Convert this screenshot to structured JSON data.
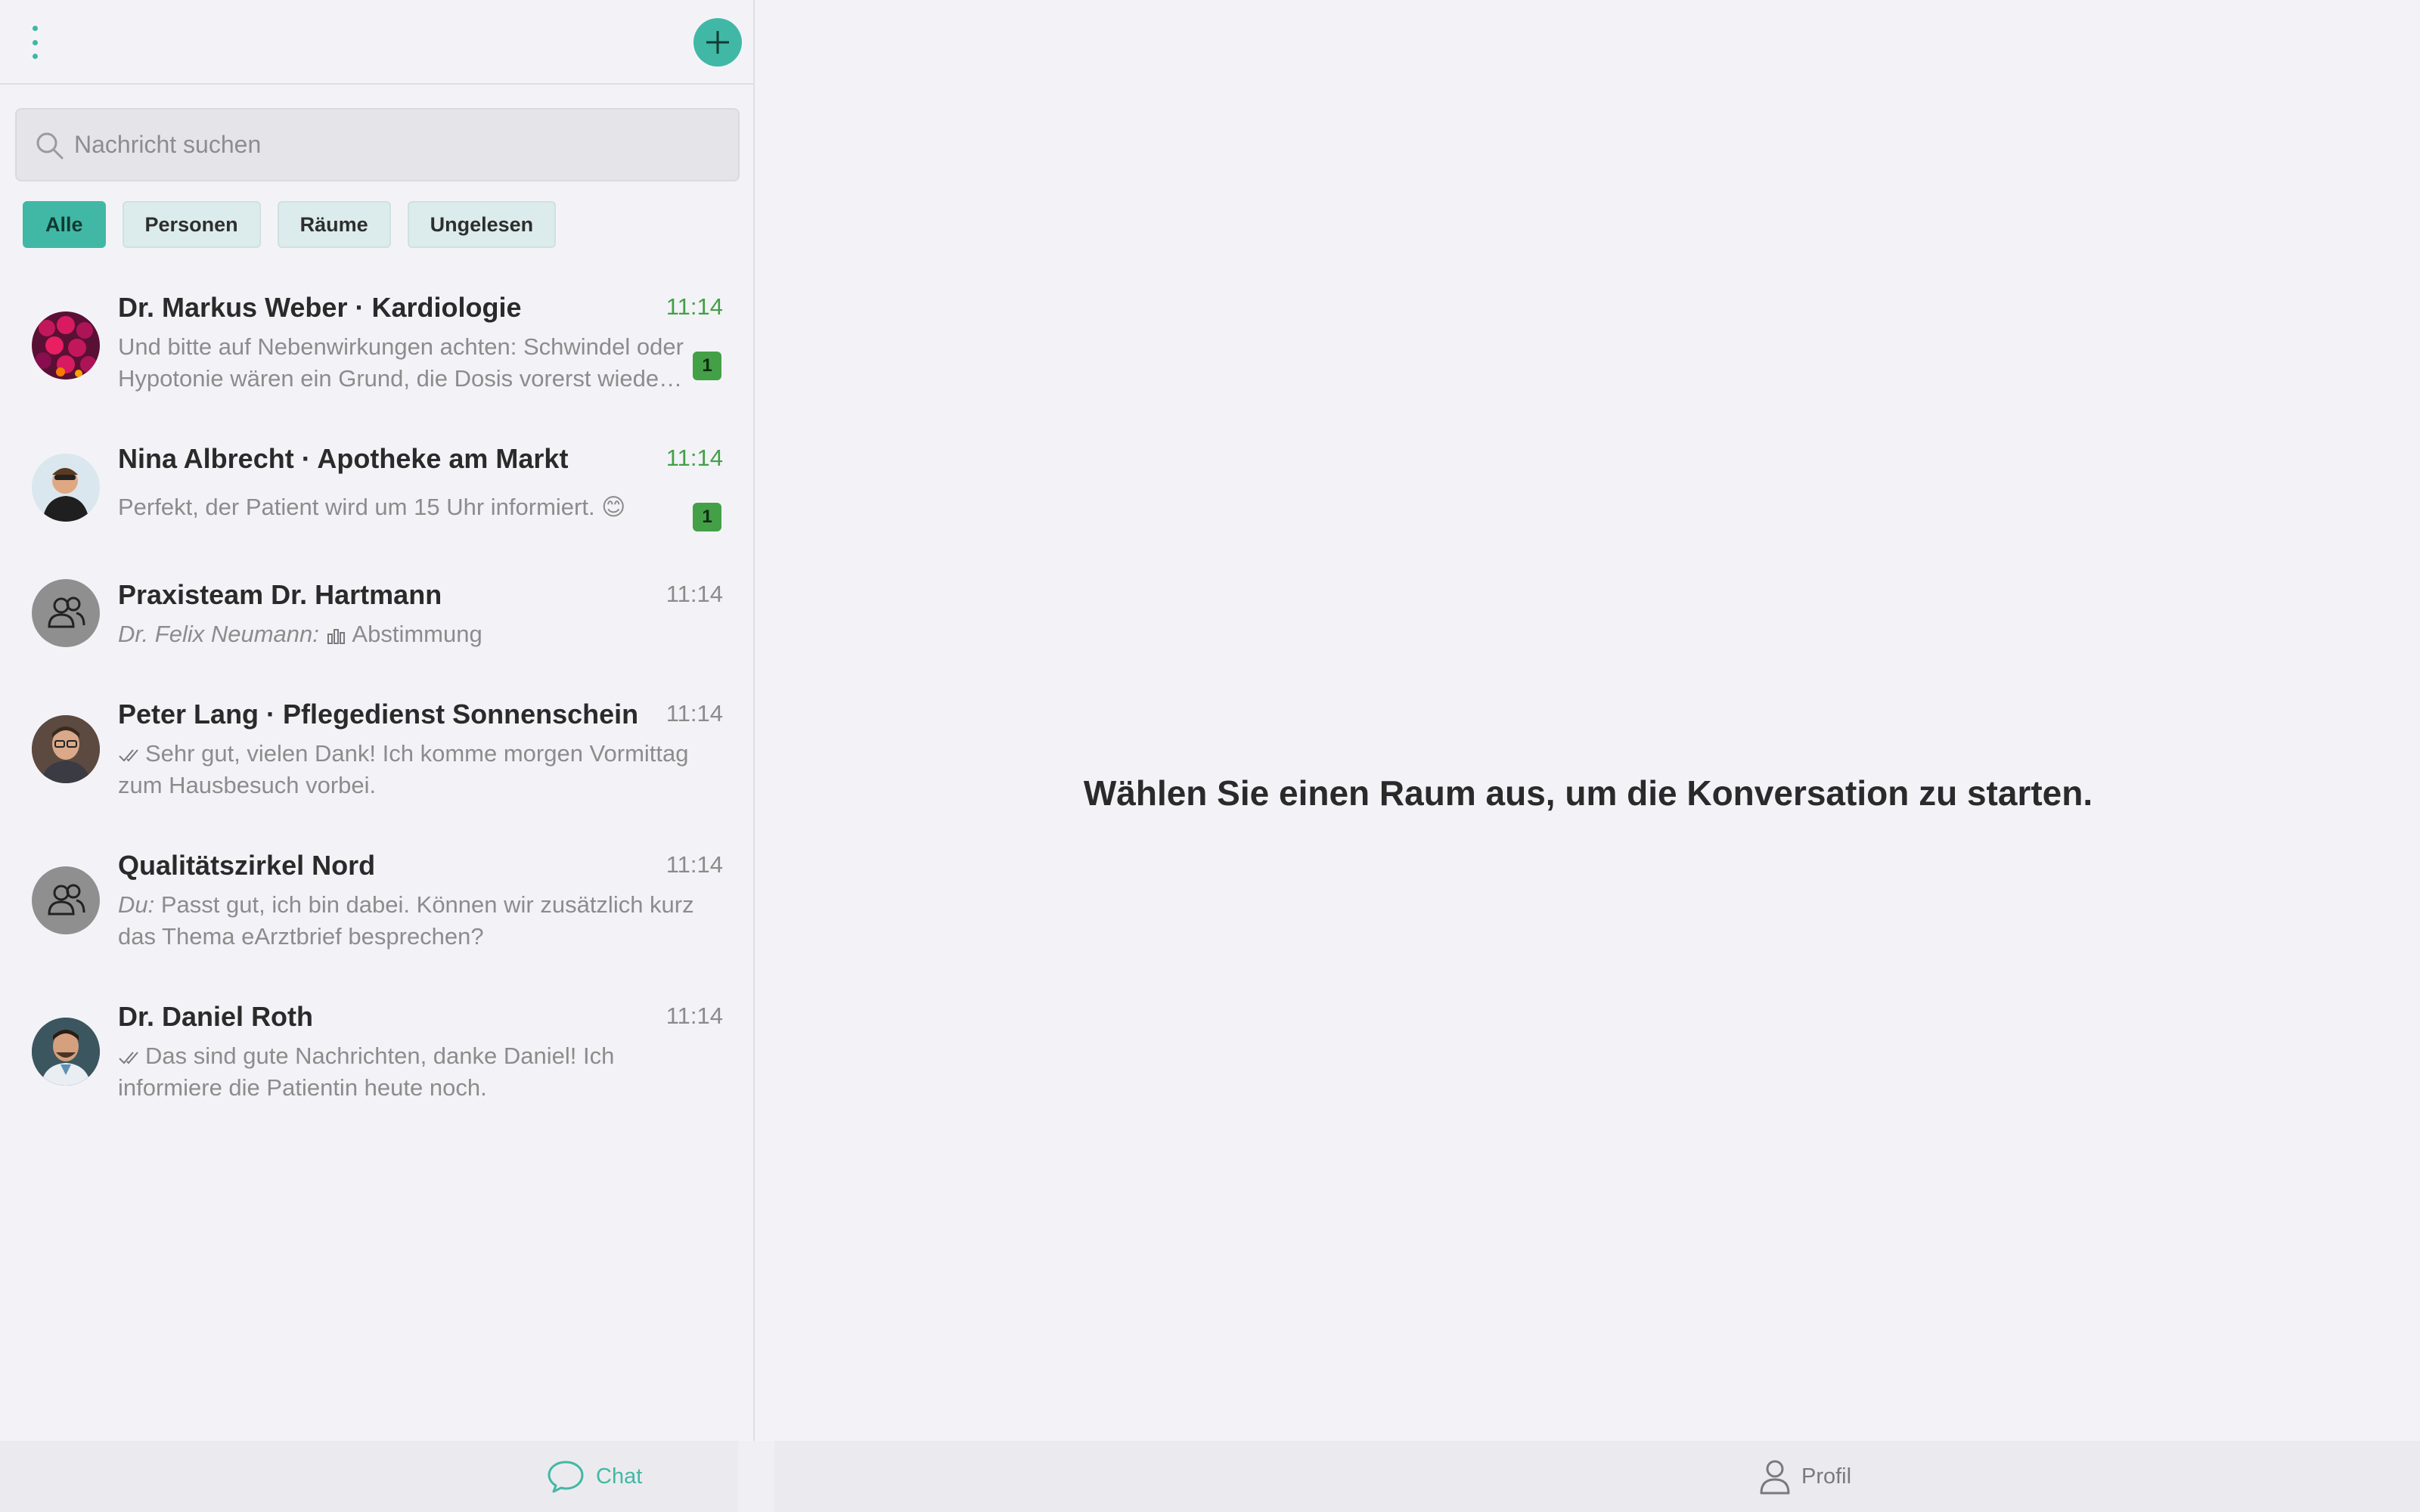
{
  "search": {
    "placeholder": "Nachricht suchen"
  },
  "filters": [
    "Alle",
    "Personen",
    "Räume",
    "Ungelesen"
  ],
  "chats": [
    {
      "title": "Dr. Markus Weber · Kardiologie",
      "time": "11:14",
      "preview": "Und bitte auf Nebenwirkungen achten: Schwindel oder Hypotonie wären ein Grund, die Dosis vorerst wieder zu reduzieren.",
      "unread": "1"
    },
    {
      "title": "Nina Albrecht · Apotheke am Markt",
      "time": "11:14",
      "preview": "Perfekt, der Patient wird um 15 Uhr informiert. 😊",
      "unread": "1"
    },
    {
      "title": "Praxisteam Dr. Hartmann",
      "time": "11:14",
      "sender": "Dr. Felix Neumann:",
      "preview": "Abstimmung"
    },
    {
      "title": "Peter Lang · Pflegedienst Sonnenschein",
      "time": "11:14",
      "preview": "Sehr gut, vielen Dank! Ich komme morgen Vormittag zum Hausbesuch vorbei."
    },
    {
      "title": "Qualitätszirkel Nord",
      "time": "11:14",
      "sender": "Du:",
      "preview": "Passt gut, ich bin dabei. Können wir zusätzlich kurz das Thema eArztbrief besprechen?"
    },
    {
      "title": "Dr. Daniel Roth",
      "time": "11:14",
      "preview": "Das sind gute Nachrichten, danke Daniel! Ich informiere die Patientin heute noch."
    }
  ],
  "main": {
    "empty_message": "Wählen Sie einen Raum aus, um die Konversation zu starten."
  },
  "nav": {
    "chat": "Chat",
    "profile": "Profil"
  },
  "colors": {
    "accent": "#41b8a5",
    "unread": "#43a047"
  }
}
